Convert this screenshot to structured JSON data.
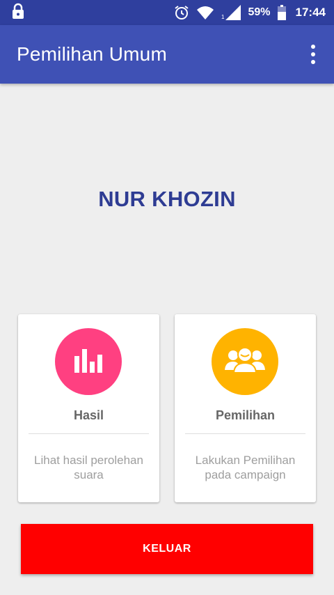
{
  "status_bar": {
    "battery_percent": "59%",
    "time": "17:44",
    "signal_sub": "1",
    "icons": [
      "lock-icon",
      "alarm-icon",
      "wifi-icon",
      "signal-icon",
      "battery-icon"
    ]
  },
  "app_bar": {
    "title": "Pemilihan Umum",
    "menu_icon": "overflow-menu-icon"
  },
  "user": {
    "name": "NUR KHOZIN"
  },
  "cards": [
    {
      "title": "Hasil",
      "description": "Lihat hasil perolehan suara",
      "icon": "bar-chart-icon",
      "color": "#ff4081"
    },
    {
      "title": "Pemilihan",
      "description": "Lakukan Pemilihan pada campaign",
      "icon": "group-icon",
      "color": "#ffb300"
    }
  ],
  "logout": {
    "label": "KELUAR",
    "color": "#ff0000"
  },
  "colors": {
    "status_bar": "#2f3f9e",
    "app_bar": "#3f51b5",
    "user_name": "#2e3c93",
    "background": "#eeeeee"
  }
}
